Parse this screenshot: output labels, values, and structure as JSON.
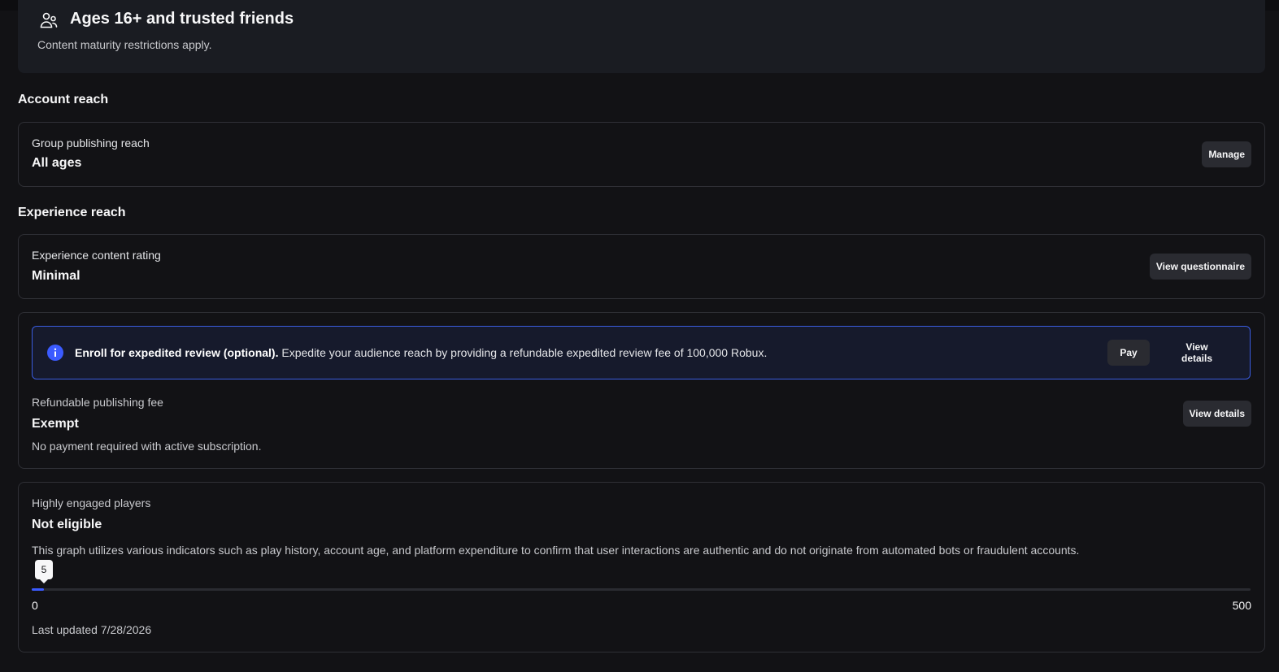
{
  "audience": {
    "title": "Ages 16+ and trusted friends",
    "subtitle": "Content maturity restrictions apply.",
    "icon": "users-icon"
  },
  "account_reach": {
    "section_title": "Account reach",
    "label": "Group publishing reach",
    "value": "All ages",
    "button": "Manage"
  },
  "experience_reach": {
    "section_title": "Experience reach",
    "label": "Experience content rating",
    "value": "Minimal",
    "button": "View questionnaire"
  },
  "review": {
    "banner_bold": "Enroll for expedited review (optional).",
    "banner_text": " Expedite your audience reach by providing a refundable expedited review fee of 100,000 Robux.",
    "pay_button": "Pay",
    "details_button": "View details",
    "icon": "info-icon",
    "accent_color": "#3a5ce0",
    "fee_label": "Refundable publishing fee",
    "fee_value": "Exempt",
    "fee_desc": "No payment required with active subscription.",
    "fee_button": "View details"
  },
  "engaged": {
    "label": "Highly engaged players",
    "value": "Not eligible",
    "desc": "This graph utilizes various indicators such as play history, account age, and platform expenditure to confirm that user interactions are authentic and do not originate from automated bots or fraudulent accounts.",
    "slider_value": "5",
    "slider_level": 5,
    "slider_min": "0",
    "slider_max": "500",
    "slider_color": "#3b5bff",
    "last_updated": "Last updated 7/28/2026"
  }
}
